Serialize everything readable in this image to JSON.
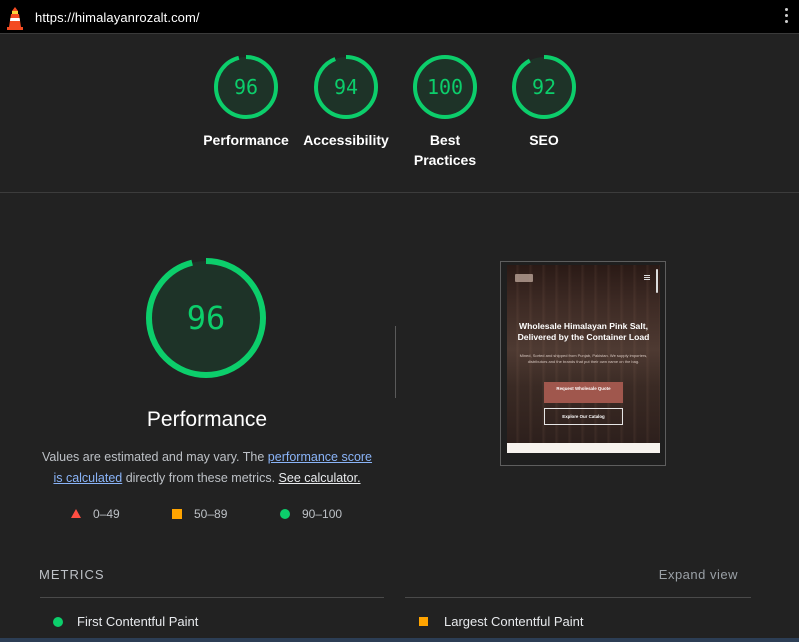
{
  "topbar": {
    "url": "https://himalayanrozalt.com/",
    "logo_icon": "lighthouse-icon",
    "menu_icon": "kebab-menu-icon"
  },
  "colors": {
    "pass": "#0cce6b",
    "average": "#ffa400",
    "fail": "#ff4e42",
    "link": "#8ab4f8",
    "background": "#222222"
  },
  "scores": [
    {
      "value": "96",
      "label": "Performance"
    },
    {
      "value": "94",
      "label": "Accessibility"
    },
    {
      "value": "100",
      "label": "Best Practices"
    },
    {
      "value": "92",
      "label": "SEO"
    }
  ],
  "performance": {
    "score": "96",
    "title": "Performance",
    "desc_prefix": "Values are estimated and may vary. The ",
    "desc_link": "performance score is calculated",
    "desc_middle": " directly from these metrics.",
    "desc_calc_link": "See calculator."
  },
  "legend": [
    {
      "icon": "triangle-fail-icon",
      "range": "0–49"
    },
    {
      "icon": "square-average-icon",
      "range": "50–89"
    },
    {
      "icon": "circle-pass-icon",
      "range": "90–100"
    }
  ],
  "screenshot": {
    "headline": "Wholesale Himalayan Pink Salt, Delivered by the Container Load",
    "subtext": "Mined, Sorted and shipped from Punjab, Pakistan. We supply importers, distributors and the brands that put their own name on the bag.",
    "primary_button": "Request Wholesale Quote",
    "secondary_button": "Explore Our Catalog"
  },
  "metrics": {
    "heading": "METRICS",
    "expand": "Expand view",
    "items": [
      {
        "label": "First Contentful Paint",
        "status": "pass"
      },
      {
        "label": "Largest Contentful Paint",
        "status": "average"
      }
    ]
  }
}
